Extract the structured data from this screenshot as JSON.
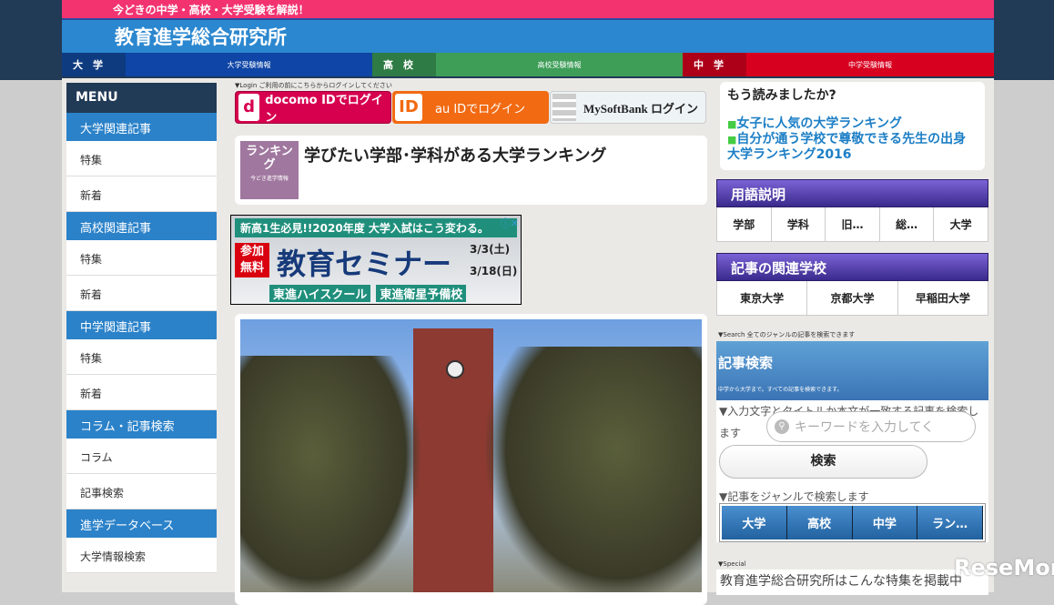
{
  "header": {
    "tagline": "今どきの中学・高校・大学受験を解説！",
    "site_title": "教育進学総合研究所",
    "nav": [
      {
        "key": "大　学",
        "sub": "大学受験情報",
        "c1": "#0e3b80",
        "c2": "#0e45a6"
      },
      {
        "key": "高　校",
        "sub": "高校受験情報",
        "c1": "#2f7b45",
        "c2": "#3e9e58"
      },
      {
        "key": "中　学",
        "sub": "中学受験情報",
        "c1": "#ad0018",
        "c2": "#d8001f"
      }
    ]
  },
  "sidebar": {
    "menu_label": "MENU",
    "sections": [
      {
        "title": "大学関連記事",
        "items": [
          "特集",
          "新着"
        ]
      },
      {
        "title": "高校関連記事",
        "items": [
          "特集",
          "新着"
        ]
      },
      {
        "title": "中学関連記事",
        "items": [
          "特集",
          "新着"
        ]
      },
      {
        "title": "コラム・記事検索",
        "items": [
          "コラム",
          "記事検索"
        ]
      },
      {
        "title": "進学データベース",
        "items": [
          "大学情報検索"
        ]
      }
    ]
  },
  "login": {
    "note": "▼Login ご利用の前にこちらからログインしてください",
    "docomo": "docomo IDでログイン",
    "au": "au IDでログイン",
    "softbank": "MySoftBank ログイン"
  },
  "article": {
    "badge_main": "ランキング",
    "badge_sub": "今どき進学情報",
    "title": "学びたい学部･学科がある大学ランキング"
  },
  "ad": {
    "headline": "新高1生必見!!2020年度 大学入試はこう変わる。",
    "free": "参加無料",
    "main": "教育セミナー",
    "date1": "3/3(土)",
    "date2": "3/18(日)",
    "school1": "東進ハイスクール",
    "school2": "東進衛星予備校"
  },
  "read": {
    "title": "もう読みましたか?",
    "links": [
      "女子に人気の大学ランキング",
      "自分が通う学校で尊敬できる先生の出身大学ランキング2016"
    ]
  },
  "glossary": {
    "title": "用語説明",
    "items": [
      "学部",
      "学科",
      "旧…",
      "総…",
      "大学"
    ]
  },
  "related": {
    "title": "記事の関連学校",
    "items": [
      "東京大学",
      "京都大学",
      "早稲田大学"
    ]
  },
  "search": {
    "note": "▼Search 全てのジャンルの記事を検索できます",
    "title": "記事検索",
    "subtitle": "中学から大学まで。すべての記事を検索できます。",
    "desc": "▼入力文字とタイトルか本文が一致する記事を検索します",
    "placeholder": "キーワードを入力してく",
    "button": "検索",
    "genre_label": "▼記事をジャンルで検索します",
    "genres": [
      "大学",
      "高校",
      "中学",
      "ラン…"
    ]
  },
  "special": {
    "note": "▼Special",
    "text": "教育進学総合研究所はこんな特集を掲載中"
  },
  "watermark": "ReseMom"
}
